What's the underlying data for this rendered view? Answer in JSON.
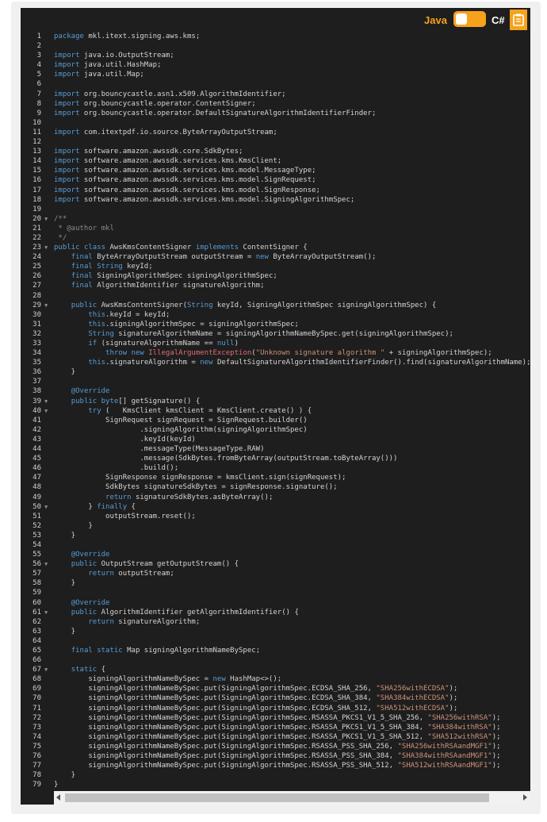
{
  "toolbar": {
    "java_label": "Java",
    "csharp_label": "C#",
    "copy_icon": "clipboard-icon",
    "accent_color": "#f7a21b"
  },
  "code": {
    "language": "java",
    "lines": [
      "package mkl.itext.signing.aws.kms;",
      "",
      "import java.io.OutputStream;",
      "import java.util.HashMap;",
      "import java.util.Map;",
      "",
      "import org.bouncycastle.asn1.x509.AlgorithmIdentifier;",
      "import org.bouncycastle.operator.ContentSigner;",
      "import org.bouncycastle.operator.DefaultSignatureAlgorithmIdentifierFinder;",
      "",
      "import com.itextpdf.io.source.ByteArrayOutputStream;",
      "",
      "import software.amazon.awssdk.core.SdkBytes;",
      "import software.amazon.awssdk.services.kms.KmsClient;",
      "import software.amazon.awssdk.services.kms.model.MessageType;",
      "import software.amazon.awssdk.services.kms.model.SignRequest;",
      "import software.amazon.awssdk.services.kms.model.SignResponse;",
      "import software.amazon.awssdk.services.kms.model.SigningAlgorithmSpec;",
      "",
      "/**",
      " * @author mkl",
      " */",
      "public class AwsKmsContentSigner implements ContentSigner {",
      "    final ByteArrayOutputStream outputStream = new ByteArrayOutputStream();",
      "    final String keyId;",
      "    final SigningAlgorithmSpec signingAlgorithmSpec;",
      "    final AlgorithmIdentifier signatureAlgorithm;",
      "",
      "    public AwsKmsContentSigner(String keyId, SigningAlgorithmSpec signingAlgorithmSpec) {",
      "        this.keyId = keyId;",
      "        this.signingAlgorithmSpec = signingAlgorithmSpec;",
      "        String signatureAlgorithmName = signingAlgorithmNameBySpec.get(signingAlgorithmSpec);",
      "        if (signatureAlgorithmName == null)",
      "            throw new IllegalArgumentException(\"Unknown signature algorithm \" + signingAlgorithmSpec);",
      "        this.signatureAlgorithm = new DefaultSignatureAlgorithmIdentifierFinder().find(signatureAlgorithmName);",
      "    }",
      "",
      "    @Override",
      "    public byte[] getSignature() {",
      "        try (   KmsClient kmsClient = KmsClient.create() ) {",
      "            SignRequest signRequest = SignRequest.builder()",
      "                    .signingAlgorithm(signingAlgorithmSpec)",
      "                    .keyId(keyId)",
      "                    .messageType(MessageType.RAW)",
      "                    .message(SdkBytes.fromByteArray(outputStream.toByteArray()))",
      "                    .build();",
      "            SignResponse signResponse = kmsClient.sign(signRequest);",
      "            SdkBytes signatureSdkBytes = signResponse.signature();",
      "            return signatureSdkBytes.asByteArray();",
      "        } finally {",
      "            outputStream.reset();",
      "        }",
      "    }",
      "",
      "    @Override",
      "    public OutputStream getOutputStream() {",
      "        return outputStream;",
      "    }",
      "",
      "    @Override",
      "    public AlgorithmIdentifier getAlgorithmIdentifier() {",
      "        return signatureAlgorithm;",
      "    }",
      "",
      "    final static Map signingAlgorithmNameBySpec;",
      "",
      "    static {",
      "        signingAlgorithmNameBySpec = new HashMap<>();",
      "        signingAlgorithmNameBySpec.put(SigningAlgorithmSpec.ECDSA_SHA_256, \"SHA256withECDSA\");",
      "        signingAlgorithmNameBySpec.put(SigningAlgorithmSpec.ECDSA_SHA_384, \"SHA384withECDSA\");",
      "        signingAlgorithmNameBySpec.put(SigningAlgorithmSpec.ECDSA_SHA_512, \"SHA512withECDSA\");",
      "        signingAlgorithmNameBySpec.put(SigningAlgorithmSpec.RSASSA_PKCS1_V1_5_SHA_256, \"SHA256withRSA\");",
      "        signingAlgorithmNameBySpec.put(SigningAlgorithmSpec.RSASSA_PKCS1_V1_5_SHA_384, \"SHA384withRSA\");",
      "        signingAlgorithmNameBySpec.put(SigningAlgorithmSpec.RSASSA_PKCS1_V1_5_SHA_512, \"SHA512withRSA\");",
      "        signingAlgorithmNameBySpec.put(SigningAlgorithmSpec.RSASSA_PSS_SHA_256, \"SHA256withRSAandMGF1\");",
      "        signingAlgorithmNameBySpec.put(SigningAlgorithmSpec.RSASSA_PSS_SHA_384, \"SHA384withRSAandMGF1\");",
      "        signingAlgorithmNameBySpec.put(SigningAlgorithmSpec.RSASSA_PSS_SHA_512, \"SHA512withRSAandMGF1\");",
      "    }",
      "}"
    ],
    "fold_lines": [
      20,
      23,
      29,
      39,
      40,
      50,
      56,
      61,
      67
    ],
    "colors": {
      "keyword": "#569cd6",
      "annotation": "#569cd6",
      "comment": "#8a8a8a",
      "string": "#ce9178",
      "exception": "#e06c75",
      "text": "#d4d4d4"
    }
  }
}
